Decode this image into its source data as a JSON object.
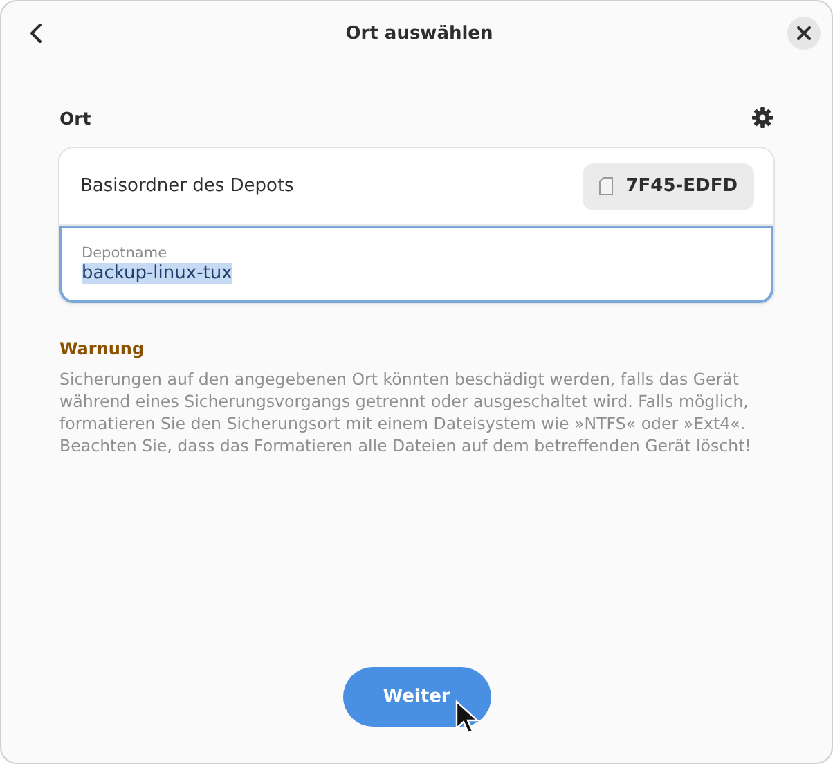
{
  "window": {
    "title": "Ort auswählen"
  },
  "section": {
    "title": "Ort"
  },
  "folder_row": {
    "label": "Basisordner des Depots",
    "drive": "7F45-EDFD"
  },
  "name_field": {
    "label": "Depotname",
    "value": "backup-linux-tux",
    "focused": true,
    "text_selected": true
  },
  "warning": {
    "title": "Warnung",
    "text": "Sicherungen auf den angegebenen Ort könnten beschädigt werden, falls das Gerät während eines Sicherungsvorgangs getrennt oder ausgeschaltet wird. Falls möglich, formatieren Sie den Sicherungsort mit einem Dateisystem wie »NTFS« oder »Ext4«. Beachten Sie, dass das Formatieren alle Dateien auf dem betreffenden Gerät löscht!"
  },
  "buttons": [
    "Weiter"
  ]
}
